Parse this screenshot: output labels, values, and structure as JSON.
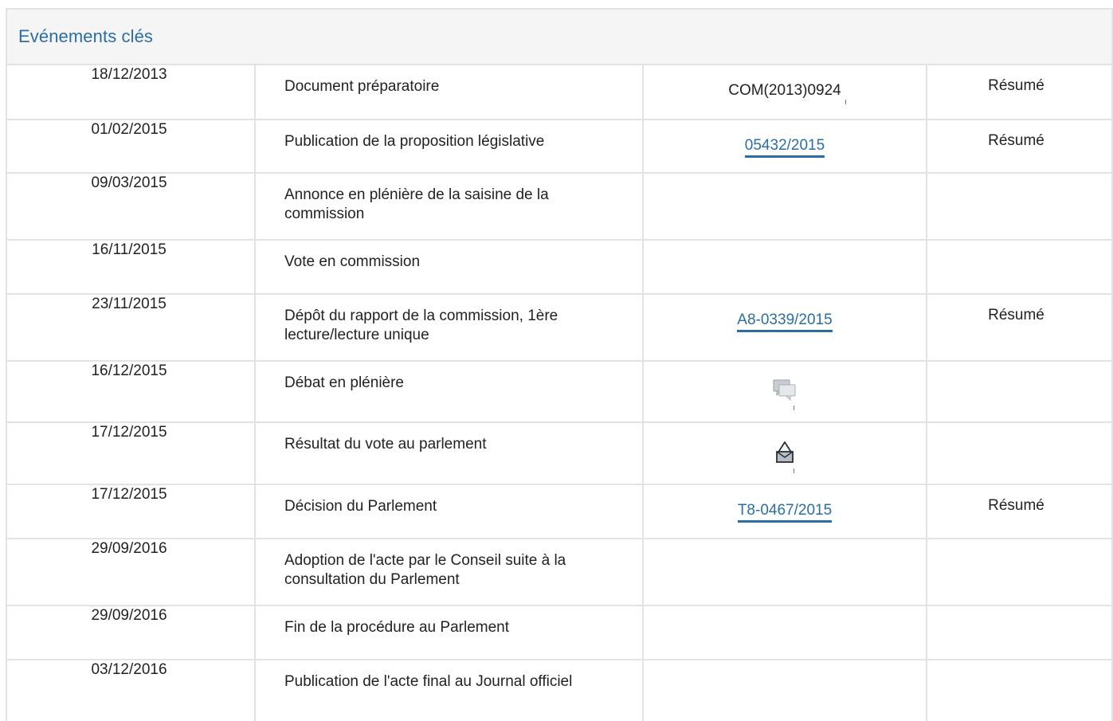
{
  "panel": {
    "title": "Evénements clés"
  },
  "rows": [
    {
      "date": "18/12/2013",
      "event": "Document préparatoire",
      "ref": "COM(2013)0924",
      "ref_type": "text",
      "summary": "Résumé"
    },
    {
      "date": "01/02/2015",
      "event": "Publication de la proposition législative",
      "ref": "05432/2015",
      "ref_type": "link",
      "summary": "Résumé"
    },
    {
      "date": "09/03/2015",
      "event": "Annonce en plénière de la saisine de la commission",
      "ref": "",
      "ref_type": "none",
      "summary": ""
    },
    {
      "date": "16/11/2015",
      "event": "Vote en commission",
      "ref": "",
      "ref_type": "none",
      "summary": ""
    },
    {
      "date": "23/11/2015",
      "event": "Dépôt du rapport de la commission, 1ère lecture/lecture unique",
      "ref": "A8-0339/2015",
      "ref_type": "link",
      "summary": "Résumé"
    },
    {
      "date": "16/12/2015",
      "event": "Débat en plénière",
      "ref": "",
      "ref_type": "icon",
      "icon": "debate-speech-bubbles-icon",
      "summary": ""
    },
    {
      "date": "17/12/2015",
      "event": "Résultat du vote au parlement",
      "ref": "",
      "ref_type": "icon",
      "icon": "ballot-box-vote-icon",
      "summary": ""
    },
    {
      "date": "17/12/2015",
      "event": "Décision du Parlement",
      "ref": "T8-0467/2015",
      "ref_type": "link",
      "summary": "Résumé"
    },
    {
      "date": "29/09/2016",
      "event": "Adoption de l'acte par le Conseil suite à la consultation du Parlement",
      "ref": "",
      "ref_type": "none",
      "summary": ""
    },
    {
      "date": "29/09/2016",
      "event": "Fin de la procédure au Parlement",
      "ref": "",
      "ref_type": "none",
      "summary": ""
    },
    {
      "date": "03/12/2016",
      "event": "Publication de l'acte final au Journal officiel",
      "ref": "",
      "ref_type": "none",
      "summary": ""
    }
  ],
  "colors": {
    "accent": "#2a6ea6",
    "border": "#e3e3e3",
    "header_bg": "#f5f5f5",
    "text": "#222222"
  }
}
